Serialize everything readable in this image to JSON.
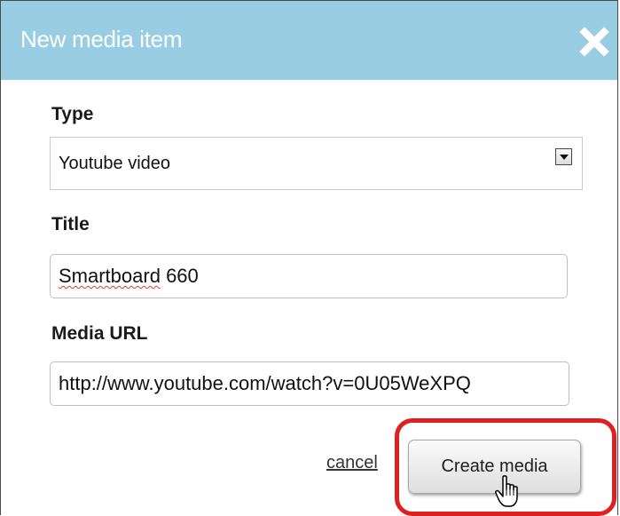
{
  "dialog": {
    "title": "New media item",
    "close_icon": "close-icon"
  },
  "form": {
    "type": {
      "label": "Type",
      "selected": "Youtube video"
    },
    "title": {
      "label": "Title",
      "value_misspelled": "Smartboard",
      "value_rest": " 660"
    },
    "media_url": {
      "label": "Media URL",
      "value": "http://www.youtube.com/watch?v=0U05WeXPQ"
    }
  },
  "actions": {
    "cancel_label": "cancel",
    "create_label": "Create media"
  },
  "annotation": {
    "highlight_color": "#e02020"
  },
  "colors": {
    "titlebar": "#99cde3"
  }
}
